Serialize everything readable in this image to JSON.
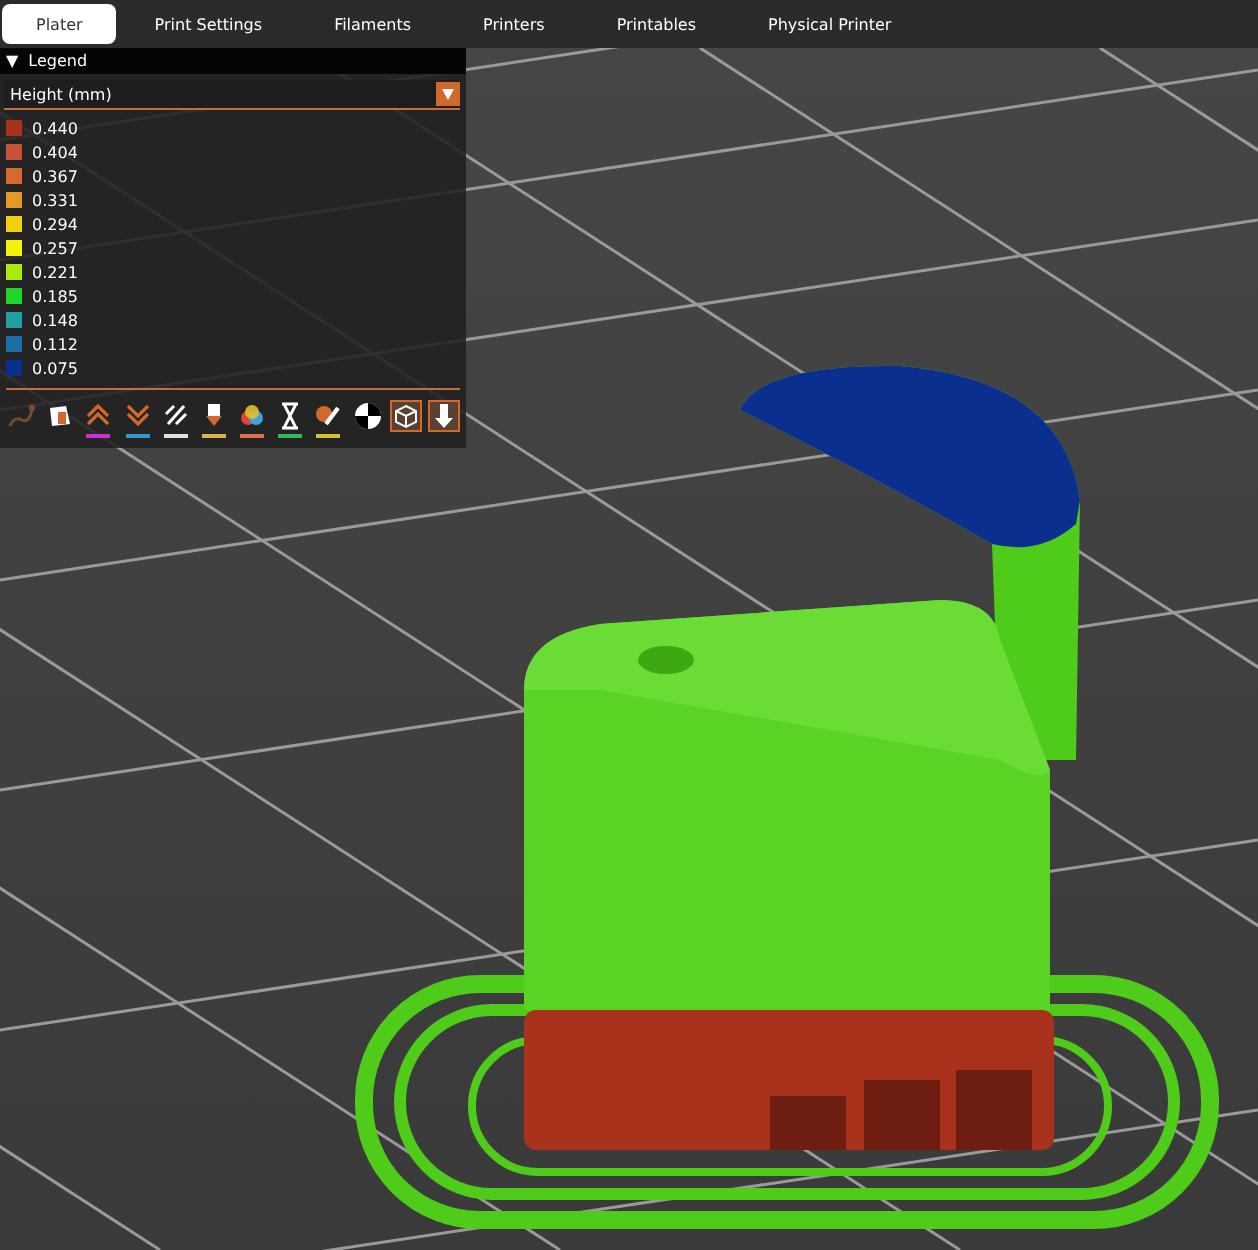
{
  "tabs": [
    {
      "label": "Plater",
      "selected": true
    },
    {
      "label": "Print Settings",
      "selected": false
    },
    {
      "label": "Filaments",
      "selected": false
    },
    {
      "label": "Printers",
      "selected": false
    },
    {
      "label": "Printables",
      "selected": false
    },
    {
      "label": "Physical Printer",
      "selected": false
    }
  ],
  "legend": {
    "toggle": "▼",
    "title": "Legend",
    "view_type": "Height (mm)",
    "items": [
      {
        "value": "0.440",
        "color": "#a8321c"
      },
      {
        "value": "0.404",
        "color": "#c8533a"
      },
      {
        "value": "0.367",
        "color": "#d46a2e"
      },
      {
        "value": "0.331",
        "color": "#e39a26"
      },
      {
        "value": "0.294",
        "color": "#f2cf0f"
      },
      {
        "value": "0.257",
        "color": "#f5f20a"
      },
      {
        "value": "0.221",
        "color": "#a6ea10"
      },
      {
        "value": "0.185",
        "color": "#20d52a"
      },
      {
        "value": "0.148",
        "color": "#1fa0a4"
      },
      {
        "value": "0.112",
        "color": "#1a6fa6"
      },
      {
        "value": "0.075",
        "color": "#0a2f8f"
      }
    ]
  },
  "options": [
    {
      "kind": "travel",
      "on": false
    },
    {
      "kind": "wipe",
      "on": true
    },
    {
      "kind": "retractions",
      "on": true,
      "color": "#cc33cc"
    },
    {
      "kind": "deretractions",
      "on": true,
      "color": "#3399cc"
    },
    {
      "kind": "seams",
      "on": true,
      "color": "#e0e0e0"
    },
    {
      "kind": "tool-changes",
      "on": true,
      "color": "#d9b44a"
    },
    {
      "kind": "color-changes",
      "on": true,
      "color": "#e07050"
    },
    {
      "kind": "pause",
      "on": true,
      "color": "#33bb55"
    },
    {
      "kind": "custom-gcode",
      "on": true,
      "color": "#d9c030"
    },
    {
      "kind": "center-of-gravity",
      "on": true
    },
    {
      "kind": "shells",
      "on": true
    },
    {
      "kind": "tool-marker",
      "on": true
    }
  ]
}
